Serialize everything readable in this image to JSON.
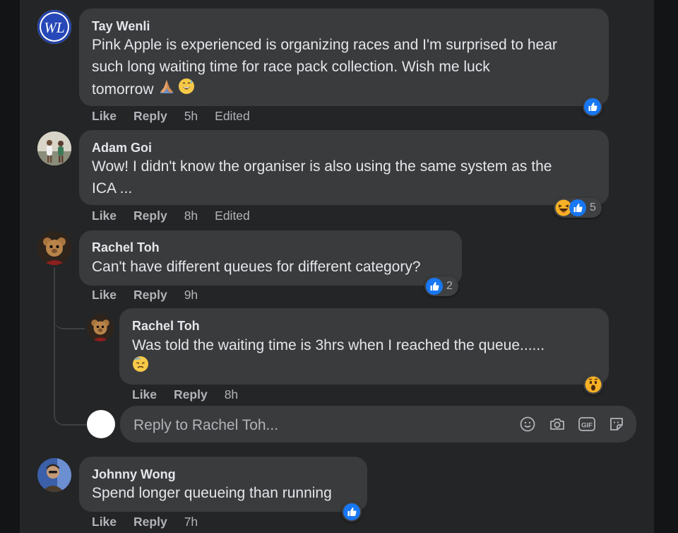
{
  "comments": [
    {
      "author": "Tay Wenli",
      "avatar_initials": "WL",
      "text_line1": "Pink Apple is experienced is organizing races and I'm surprised to hear",
      "text_line2": "such long waiting time for race pack collection. Wish me luck",
      "text_line3": "tomorrow",
      "text_emojis": [
        "folded-hands",
        "grinning-sweat"
      ],
      "like": "Like",
      "reply": "Reply",
      "time": "5h",
      "edited": "Edited",
      "reactions": [
        "like"
      ],
      "reaction_count": ""
    },
    {
      "author": "Adam Goi",
      "text_line1": "Wow! I didn't know the organiser is also using the same system as the",
      "text_line2": "ICA ...",
      "like": "Like",
      "reply": "Reply",
      "time": "8h",
      "edited": "Edited",
      "reactions": [
        "haha",
        "like"
      ],
      "reaction_count": "5"
    },
    {
      "author": "Rachel Toh",
      "text_line1": "Can't have different queues for different category?",
      "like": "Like",
      "reply": "Reply",
      "time": "9h",
      "reactions": [
        "like"
      ],
      "reaction_count": "2",
      "replies": [
        {
          "author": "Rachel Toh",
          "text_line1": "Was told the waiting time is 3hrs when I reached the queue......",
          "text_emoji": "downcast-sweat",
          "like": "Like",
          "reply": "Reply",
          "time": "8h",
          "reactions": [
            "wow"
          ],
          "reaction_count": ""
        }
      ]
    },
    {
      "author": "Johnny Wong",
      "text_line1": "Spend longer queueing than running",
      "like": "Like",
      "reply": "Reply",
      "time": "7h",
      "reactions": [
        "like"
      ],
      "reaction_count": ""
    }
  ],
  "reply_box": {
    "placeholder": "Reply to Rachel Toh...",
    "tools": [
      "emoji-icon",
      "camera-icon",
      "gif-icon",
      "sticker-icon"
    ],
    "gif_label": "GIF"
  },
  "colors": {
    "background": "#18191a",
    "panel": "#242526",
    "bubble": "#3a3b3c",
    "text": "#e4e6eb",
    "secondary": "#b0b3b8",
    "like_blue": "#1877f2"
  }
}
